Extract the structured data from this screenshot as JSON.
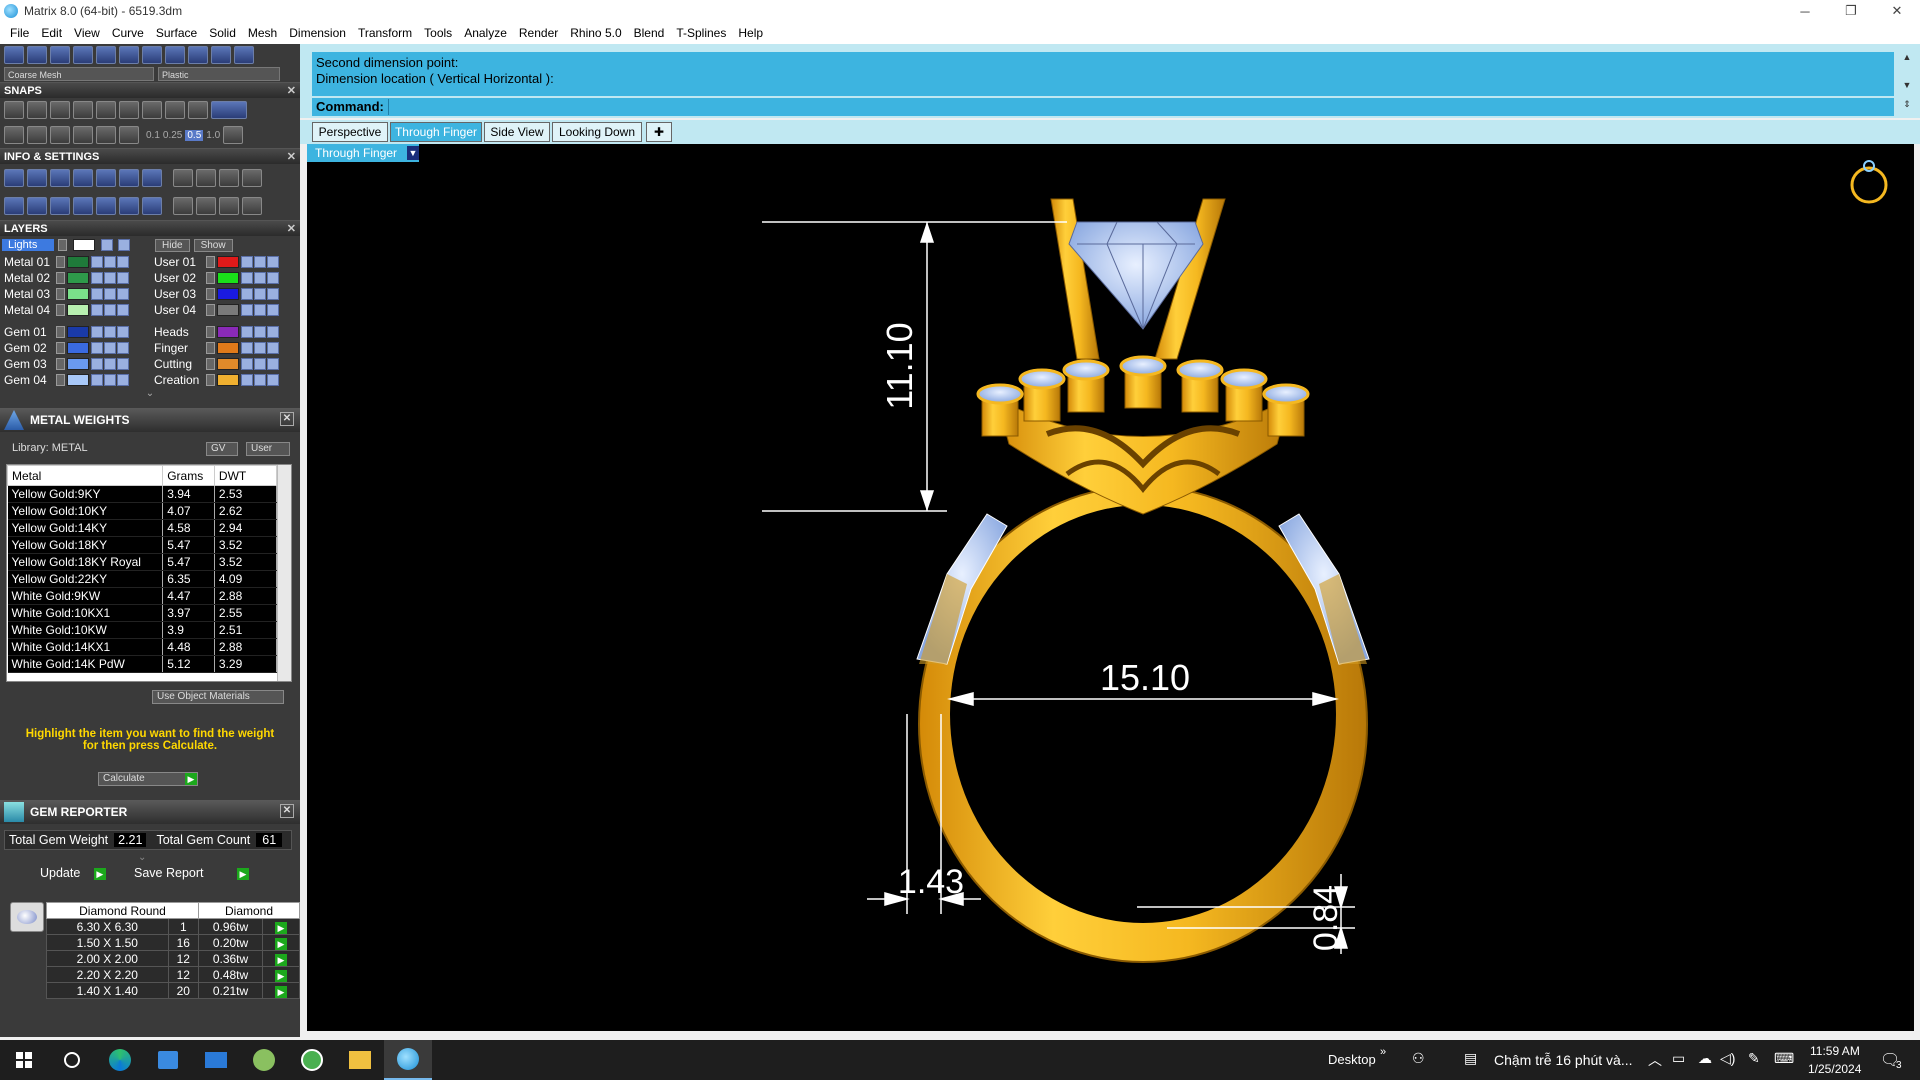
{
  "window": {
    "title": "Matrix 8.0 (64-bit) - 6519.3dm",
    "min_label": "─",
    "max_label": "❐",
    "close_label": "✕"
  },
  "menu": [
    "File",
    "Edit",
    "View",
    "Curve",
    "Surface",
    "Solid",
    "Mesh",
    "Dimension",
    "Transform",
    "Tools",
    "Analyze",
    "Render",
    "Rhino 5.0",
    "Blend",
    "T-Splines",
    "Help"
  ],
  "toolbar": {
    "mesh_combo": "Coarse Mesh",
    "material_combo": "Plastic",
    "snap_values": [
      "0.1",
      "0.25",
      "0.5",
      "1.0"
    ]
  },
  "snaps": {
    "title": "SNAPS"
  },
  "info": {
    "title": "INFO & SETTINGS"
  },
  "layers": {
    "title": "LAYERS",
    "lights_label": "Lights",
    "hide_label": "Hide",
    "show_label": "Show",
    "left": [
      {
        "name": "Metal 01",
        "color": "#1f7a3a"
      },
      {
        "name": "Metal 02",
        "color": "#2e9a4a"
      },
      {
        "name": "Metal 03",
        "color": "#7ae08a"
      },
      {
        "name": "Metal 04",
        "color": "#b8f0b0"
      },
      {
        "name": "Gem 01",
        "color": "#1a3aa8"
      },
      {
        "name": "Gem 02",
        "color": "#3a6ae0"
      },
      {
        "name": "Gem 03",
        "color": "#6a9af0"
      },
      {
        "name": "Gem 04",
        "color": "#a8c8f8"
      }
    ],
    "right": [
      {
        "name": "User 01",
        "color": "#e01a1a"
      },
      {
        "name": "User 02",
        "color": "#1ae01a"
      },
      {
        "name": "User 03",
        "color": "#1a1ae0"
      },
      {
        "name": "User 04",
        "color": "#7a7a7a"
      },
      {
        "name": "Heads",
        "color": "#8a2ab8"
      },
      {
        "name": "Finger",
        "color": "#e07a1a"
      },
      {
        "name": "Cutting",
        "color": "#e08a2a"
      },
      {
        "name": "Creation",
        "color": "#f0b030"
      }
    ]
  },
  "metal_weights": {
    "title": "METAL WEIGHTS",
    "library": "Library: METAL",
    "gv_label": "GV",
    "user_label": "User",
    "columns": [
      "Metal",
      "Grams",
      "DWT"
    ],
    "rows": [
      [
        "Yellow Gold:9KY",
        "3.94",
        "2.53"
      ],
      [
        "Yellow Gold:10KY",
        "4.07",
        "2.62"
      ],
      [
        "Yellow Gold:14KY",
        "4.58",
        "2.94"
      ],
      [
        "Yellow Gold:18KY",
        "5.47",
        "3.52"
      ],
      [
        "Yellow Gold:18KY Royal",
        "5.47",
        "3.52"
      ],
      [
        "Yellow Gold:22KY",
        "6.35",
        "4.09"
      ],
      [
        "White Gold:9KW",
        "4.47",
        "2.88"
      ],
      [
        "White Gold:10KX1",
        "3.97",
        "2.55"
      ],
      [
        "White Gold:10KW",
        "3.9",
        "2.51"
      ],
      [
        "White Gold:14KX1",
        "4.48",
        "2.88"
      ],
      [
        "White Gold:14K PdW",
        "5.12",
        "3.29"
      ]
    ],
    "use_object_materials": "Use Object Materials",
    "hint": "Highlight the item you want to find the weight for then press Calculate.",
    "calculate": "Calculate"
  },
  "gem_reporter": {
    "title": "GEM REPORTER",
    "total_weight_label": "Total Gem Weight",
    "total_weight": "2.21",
    "total_count_label": "Total Gem Count",
    "total_count": "61",
    "update": "Update",
    "save_report": "Save Report",
    "columns": [
      "Diamond Round",
      "Diamond"
    ],
    "rows": [
      [
        "6.30 X 6.30",
        "1",
        "0.96tw"
      ],
      [
        "1.50 X 1.50",
        "16",
        "0.20tw"
      ],
      [
        "2.00 X 2.00",
        "12",
        "0.36tw"
      ],
      [
        "2.20 X 2.20",
        "12",
        "0.48tw"
      ],
      [
        "1.40 X 1.40",
        "20",
        "0.21tw"
      ]
    ]
  },
  "command": {
    "history_1": "Second dimension point:",
    "history_2": "Dimension location ( Vertical  Horizontal ):",
    "label": "Command:",
    "value": ""
  },
  "tabs": [
    "Perspective",
    "Through Finger",
    "Side View",
    "Looking Down",
    "✚"
  ],
  "active_tab": "Through Finger",
  "viewport": {
    "view_name": "Through Finger",
    "dims": {
      "height": "11.10",
      "inner": "15.10",
      "band": "1.43",
      "thickness": "0.84"
    }
  },
  "taskbar": {
    "desktop": "Desktop",
    "notification": "Chậm trễ 16 phút và...",
    "time": "11:59 AM",
    "date": "1/25/2024",
    "badge": "3"
  },
  "colors": {
    "gold": "#f5b820",
    "gold_dark": "#b07a08",
    "gem": "#a8c4f0",
    "accent": "#3db4e0"
  }
}
